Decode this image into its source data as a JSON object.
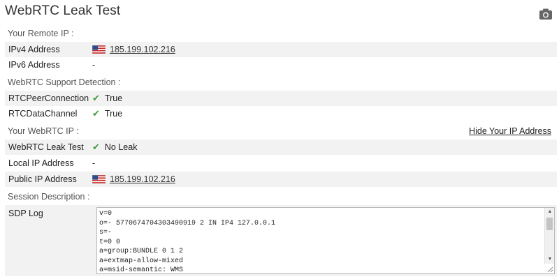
{
  "page": {
    "title": "WebRTC Leak Test"
  },
  "remote_ip": {
    "section_label": "Your Remote IP :",
    "ipv4_label": "IPv4 Address",
    "ipv4_value": "185.199.102.216",
    "ipv6_label": "IPv6 Address",
    "ipv6_value": "-"
  },
  "support": {
    "section_label": "WebRTC Support Detection :",
    "peer_label": "RTCPeerConnection",
    "peer_value": "True",
    "data_label": "RTCDataChannel",
    "data_value": "True"
  },
  "webrtc_ip": {
    "section_label": "Your WebRTC IP :",
    "hide_link": "Hide Your IP Address",
    "leak_label": "WebRTC Leak Test",
    "leak_value": "No Leak",
    "local_label": "Local IP Address",
    "local_value": "-",
    "public_label": "Public IP Address",
    "public_value": "185.199.102.216"
  },
  "session": {
    "section_label": "Session Description :",
    "sdp_label": "SDP Log",
    "sdp_lines": [
      "v=0",
      "o=- 5770674704303490919 2 IN IP4 127.0.0.1",
      "s=-",
      "t=0 0",
      "a=group:BUNDLE 0 1 2",
      "a=extmap-allow-mixed",
      "a=msid-semantic: WMS"
    ]
  },
  "icons": {
    "camera": "camera-icon",
    "flag": "us-flag-icon",
    "check": "checkmark-icon"
  },
  "colors": {
    "check": "#3a9a3a",
    "row_shade": "#f2f2f2"
  }
}
